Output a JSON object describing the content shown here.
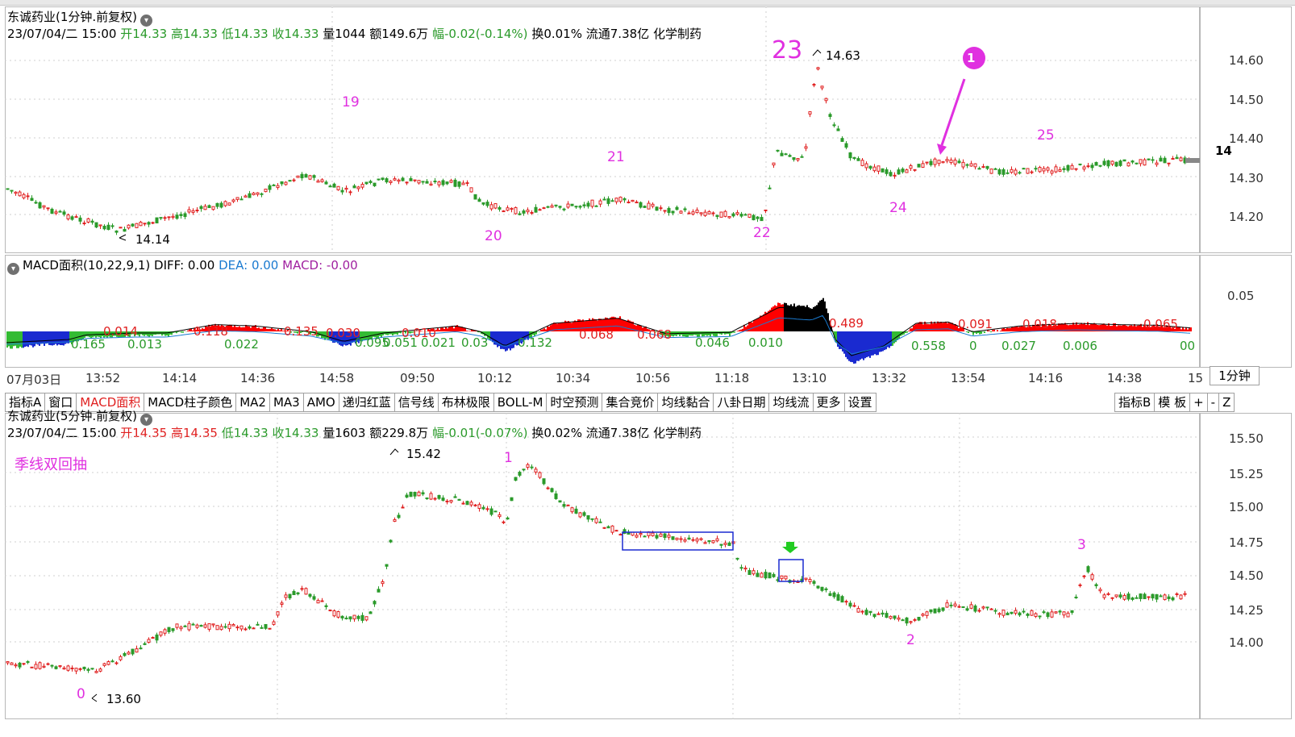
{
  "top_panel": {
    "title": "东诚药业(1分钟.前复权)",
    "date": "23/07/04/二 15:00",
    "open_label": "开",
    "open": "14.33",
    "high_label": "高",
    "high": "14.33",
    "low_label": "低",
    "low": "14.33",
    "close_label": "收",
    "close": "14.33",
    "vol_label": "量",
    "vol": "1044",
    "amt_label": "额",
    "amt": "149.6万",
    "chg_label": "幅",
    "chg": "-0.02(-0.14%)",
    "turn": "换0.01%",
    "float": "流通7.38亿",
    "sector": "化学制药",
    "price_labels": [
      "14.60",
      "14.50",
      "14.40",
      "14.30",
      "14.20"
    ],
    "annotations": {
      "n19": "19",
      "n20": "20",
      "n21": "21",
      "n22": "22",
      "n23": "23",
      "n24": "24",
      "n25": "25"
    },
    "hi_label": "14.63",
    "lo_label": "14.14",
    "marker": "1",
    "edge_price": "14"
  },
  "macd_panel": {
    "title": "MACD面积(10,22,9,1)",
    "diff": "DIFF: 0.00",
    "dea": "DEA: 0.00",
    "macd": "MACD: -0.00",
    "level": "0.05",
    "green_labels": [
      "0.165",
      "0.013",
      "0.022",
      "0.095",
      "0.051",
      "0.021",
      "0.03",
      "0.132",
      "0.046",
      "0.010",
      "0.558",
      "0",
      "0.027",
      "0.006",
      "00"
    ],
    "red_labels": [
      "0.014",
      "0.118",
      "0.135",
      "0.030",
      "0.010",
      "0.068",
      "0.068",
      "0.489",
      "0.091",
      "0.018",
      "0.065"
    ]
  },
  "time_axis": [
    "07月03日",
    "13:52",
    "14:14",
    "14:36",
    "14:58",
    "09:50",
    "10:12",
    "10:34",
    "10:56",
    "11:18",
    "13:10",
    "13:32",
    "13:54",
    "14:16",
    "14:38",
    "15"
  ],
  "period_button": "1分钟",
  "toolbar": {
    "items": [
      "指标A",
      "窗口",
      "MACD面积",
      "MACD柱子颜色",
      "MA2",
      "MA3",
      "AMO",
      "递归红蓝",
      "信号线",
      "布林极限",
      "BOLL-M",
      "时空预测",
      "集合竞价",
      "均线黏合",
      "八卦日期",
      "均线流",
      "更多",
      "设置"
    ],
    "active": "MACD面积",
    "right_items": [
      "指标B",
      "模 板",
      "+",
      "-",
      "Z"
    ]
  },
  "bottom_panel": {
    "title": "东诚药业(5分钟.前复权)",
    "date": "23/07/04/二 15:00",
    "open_label": "开",
    "open": "14.35",
    "high_label": "高",
    "high": "14.35",
    "low_label": "低",
    "low": "14.33",
    "close_label": "收",
    "close": "14.33",
    "vol_label": "量",
    "vol": "1603",
    "amt_label": "额",
    "amt": "229.8万",
    "chg_label": "幅",
    "chg": "-0.01(-0.07%)",
    "turn": "换0.02%",
    "float": "流通7.38亿",
    "sector": "化学制药",
    "note": "季线双回抽",
    "price_labels": [
      "15.50",
      "15.25",
      "15.00",
      "14.75",
      "14.50",
      "14.25",
      "14.00"
    ],
    "hi_label": "15.42",
    "lo_label": "13.60",
    "annotations": {
      "n0": "0",
      "n1": "1",
      "n2": "2",
      "n3": "3"
    }
  },
  "colors": {
    "up": "#e02020",
    "down": "#2a9a2a",
    "accent": "#e030e0",
    "box": "#1a2ad0"
  }
}
